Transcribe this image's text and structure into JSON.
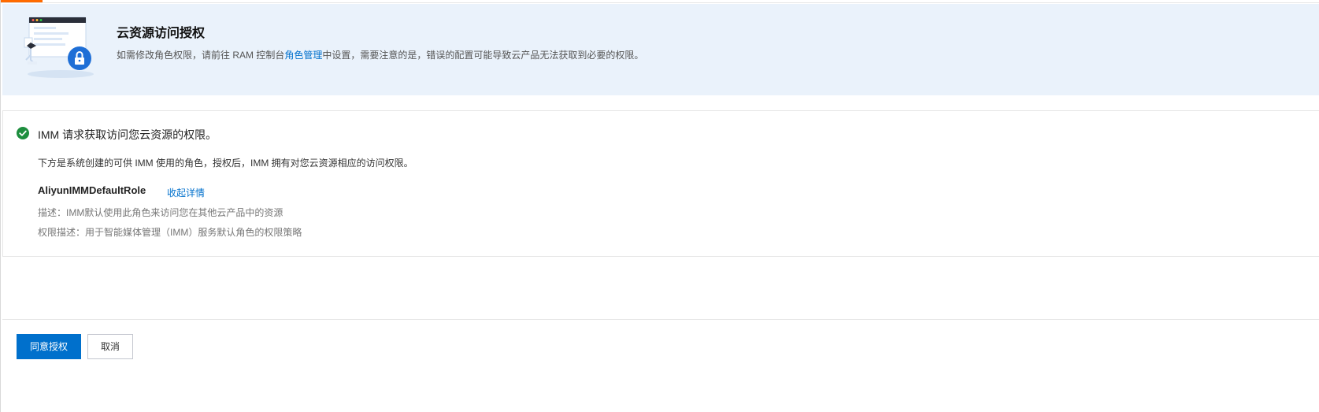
{
  "banner": {
    "title": "云资源访问授权",
    "desc_prefix": "如需修改角色权限，请前往 RAM 控制台",
    "desc_link": "角色管理",
    "desc_suffix": "中设置，需要注意的是，错误的配置可能导致云产品无法获取到必要的权限。",
    "illustration_icon": "lock-icon"
  },
  "request": {
    "status_icon": "check-circle-icon",
    "title": "IMM 请求获取访问您云资源的权限。",
    "desc": "下方是系统创建的可供 IMM 使用的角色，授权后，IMM 拥有对您云资源相应的访问权限。"
  },
  "role": {
    "name": "AliyunIMMDefaultRole",
    "collapse_label": "收起详情",
    "description": "描述：IMM默认使用此角色来访问您在其他云产品中的资源",
    "permission": "权限描述：用于智能媒体管理（IMM）服务默认角色的权限策略"
  },
  "actions": {
    "confirm_label": "同意授权",
    "cancel_label": "取消"
  },
  "colors": {
    "accent": "#0070cc",
    "top_accent": "#ff6a00",
    "banner_bg": "#eaf2fb",
    "success": "#1e8e3e"
  }
}
